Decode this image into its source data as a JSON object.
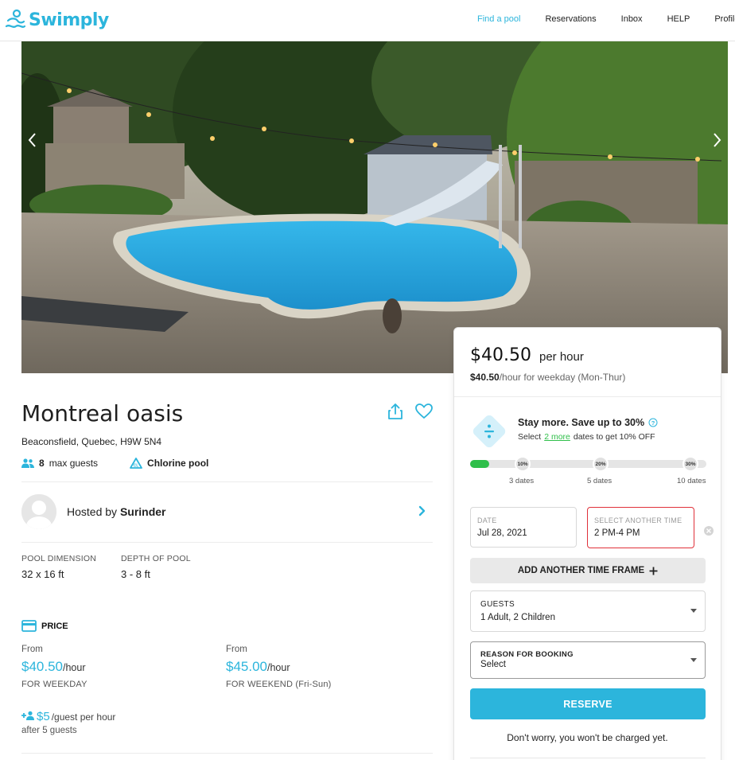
{
  "brand": {
    "name": "Swimply",
    "color": "#2cb5dc",
    "logo_icon": "swimmer-icon"
  },
  "nav": {
    "items": [
      {
        "label": "Find a pool",
        "active": true
      },
      {
        "label": "Reservations",
        "active": false
      },
      {
        "label": "Inbox",
        "active": false
      },
      {
        "label": "HELP",
        "active": false
      },
      {
        "label": "Profile",
        "active": false
      }
    ]
  },
  "gallery": {
    "prev_icon": "chevron-left-icon",
    "next_icon": "chevron-right-icon"
  },
  "listing": {
    "title": "Montreal oasis",
    "address": "Beaconsfield, Quebec, H9W 5N4",
    "max_guests_count": "8",
    "max_guests_label": "max guests",
    "pool_type": "Chlorine pool",
    "share_icon": "share-icon",
    "favorite_icon": "heart-icon"
  },
  "host": {
    "prefix": "Hosted by",
    "name": "Surinder"
  },
  "specs": [
    {
      "label": "POOL DIMENSION",
      "value": "32 x 16 ft"
    },
    {
      "label": "DEPTH OF POOL",
      "value": "3 - 8 ft"
    }
  ],
  "pricing": {
    "heading": "PRICE",
    "weekday": {
      "from": "From",
      "amount": "$40.50",
      "unit": "/hour",
      "label": "FOR WEEKDAY"
    },
    "weekend": {
      "from": "From",
      "amount": "$45.00",
      "unit": "/hour",
      "label": "FOR WEEKEND (Fri-Sun)"
    },
    "guest_fee": {
      "amount": "$5",
      "unit": "/guest per hour",
      "after": "after 5 guests"
    }
  },
  "booking": {
    "price": "$40.50",
    "per": "per hour",
    "sub_amount": "$40.50",
    "sub_text": "/hour for weekday (Mon-Thur)",
    "discount": {
      "title": "Stay more. Save up to 30%",
      "sub_prefix": "Select",
      "sub_link": "2 more",
      "sub_suffix": "dates to get 10% OFF",
      "progress": 0.08,
      "milestones": [
        {
          "badge": "10%",
          "label": "3 dates"
        },
        {
          "badge": "20%",
          "label": "5 dates"
        },
        {
          "badge": "30%",
          "label": "10 dates"
        }
      ]
    },
    "date": {
      "label": "DATE",
      "value": "Jul 28, 2021"
    },
    "time": {
      "label": "SELECT ANOTHER TIME",
      "value": "2 PM-4 PM"
    },
    "add_time_label": "ADD ANOTHER TIME FRAME",
    "guests": {
      "label": "GUESTS",
      "value": "1 Adult,  2 Children"
    },
    "reason": {
      "label": "REASON FOR BOOKING",
      "value": "Select"
    },
    "reserve_label": "RESERVE",
    "note": "Don't worry, you won't be charged yet."
  }
}
